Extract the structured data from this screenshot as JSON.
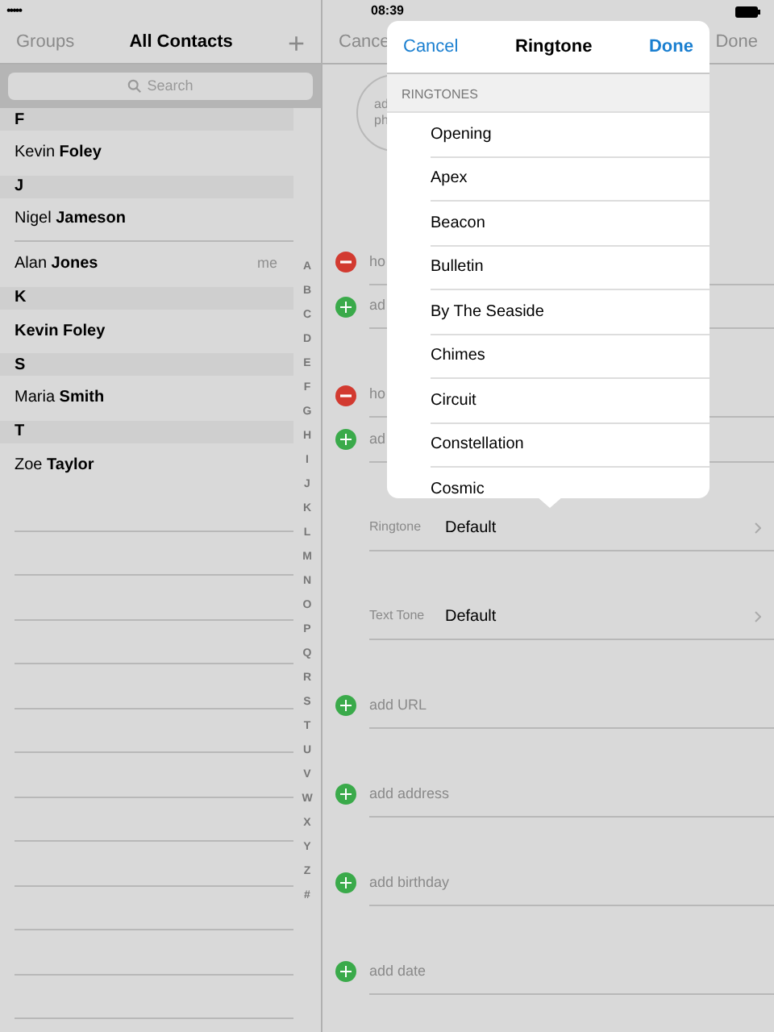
{
  "status_bar": {
    "signal": "•••••",
    "time": "08:39"
  },
  "contacts": {
    "nav": {
      "groups": "Groups",
      "title": "All Contacts",
      "add": "+"
    },
    "search": {
      "placeholder": "Search"
    },
    "sections": [
      {
        "letter": "F",
        "contacts": [
          {
            "name": "Kevin **Foley**",
            "emphasis": false
          }
        ]
      },
      {
        "letter": "J",
        "contacts": [
          {
            "name": "Nigel **Jameson**",
            "emphasis": false
          },
          {
            "name": "Alan **Jones**",
            "emphasis": false,
            "badge": "me"
          }
        ]
      },
      {
        "letter": "K",
        "contacts": [
          {
            "name": "Kevin Foley",
            "emphasis": true
          }
        ]
      },
      {
        "letter": "S",
        "contacts": [
          {
            "name": "Maria **Smith**",
            "emphasis": false
          }
        ]
      },
      {
        "letter": "T",
        "contacts": [
          {
            "name": "Zoe **Taylor**",
            "emphasis": false
          }
        ]
      }
    ],
    "index": [
      "A",
      "B",
      "C",
      "D",
      "E",
      "F",
      "G",
      "H",
      "I",
      "J",
      "K",
      "L",
      "M",
      "N",
      "O",
      "P",
      "Q",
      "R",
      "S",
      "T",
      "U",
      "V",
      "W",
      "X",
      "Y",
      "Z",
      "#"
    ]
  },
  "editor": {
    "nav": {
      "cancel": "Cance",
      "done": "Done"
    },
    "photo": [
      "ad",
      "ph"
    ],
    "groups": [
      [
        {
          "kind": "remove",
          "label": "ho"
        },
        {
          "kind": "add",
          "label": "ad"
        }
      ],
      [
        {
          "kind": "remove",
          "label": "ho"
        },
        {
          "kind": "add",
          "label": "ad"
        }
      ],
      [
        {
          "kind": "setting",
          "label": "Ringtone",
          "value": "Default"
        }
      ],
      [
        {
          "kind": "setting",
          "label": "Text Tone",
          "value": "Default"
        }
      ],
      [
        {
          "kind": "add",
          "label": "add URL"
        }
      ],
      [
        {
          "kind": "add",
          "label": "add address"
        }
      ],
      [
        {
          "kind": "add",
          "label": "add birthday"
        }
      ],
      [
        {
          "kind": "add",
          "label": "add date"
        }
      ]
    ]
  },
  "popover": {
    "cancel": "Cancel",
    "title": "Ringtone",
    "done": "Done",
    "section": "RINGTONES",
    "items": [
      "Opening",
      "Apex",
      "Beacon",
      "Bulletin",
      "By The Seaside",
      "Chimes",
      "Circuit",
      "Constellation",
      "Cosmic"
    ]
  }
}
